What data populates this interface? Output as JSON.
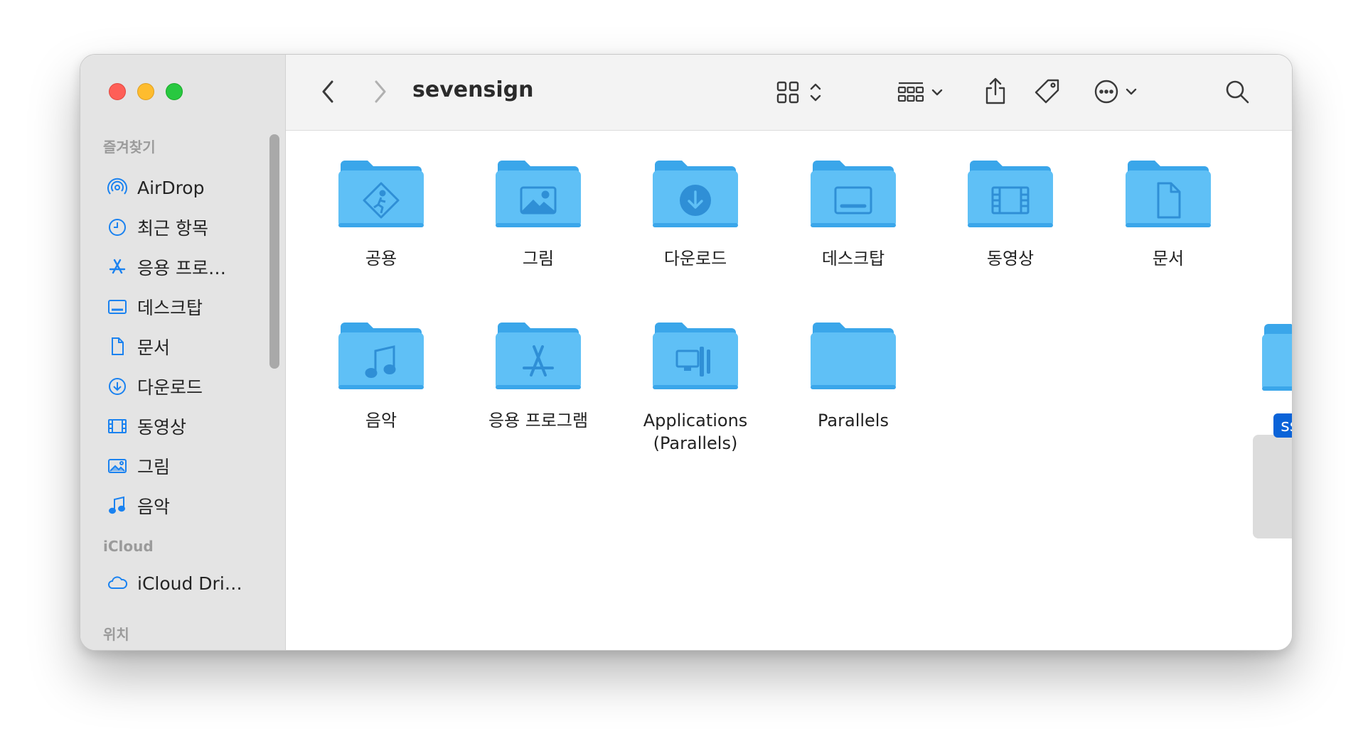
{
  "window": {
    "title": "sevensign"
  },
  "sidebar": {
    "favorites_label": "즐겨찾기",
    "favorites": [
      {
        "label": "AirDrop",
        "icon": "airdrop-icon"
      },
      {
        "label": "최근 항목",
        "icon": "clock-icon"
      },
      {
        "label": "응용 프로…",
        "icon": "apps-icon"
      },
      {
        "label": "데스크탑",
        "icon": "desktop-icon"
      },
      {
        "label": "문서",
        "icon": "document-icon"
      },
      {
        "label": "다운로드",
        "icon": "download-icon"
      },
      {
        "label": "동영상",
        "icon": "film-icon"
      },
      {
        "label": "그림",
        "icon": "photo-icon"
      },
      {
        "label": "음악",
        "icon": "music-icon"
      }
    ],
    "icloud_label": "iCloud",
    "icloud": [
      {
        "label": "iCloud Dri…",
        "icon": "cloud-icon"
      }
    ],
    "locations_label": "위치"
  },
  "files": [
    {
      "label": "공용",
      "icon": "public-folder-icon"
    },
    {
      "label": "그림",
      "icon": "pictures-folder-icon"
    },
    {
      "label": "다운로드",
      "icon": "downloads-folder-icon"
    },
    {
      "label": "데스크탑",
      "icon": "desktop-folder-icon"
    },
    {
      "label": "동영상",
      "icon": "movies-folder-icon"
    },
    {
      "label": "문서",
      "icon": "documents-folder-icon"
    },
    {
      "label": "음악",
      "icon": "music-folder-icon"
    },
    {
      "label": "응용 프로그램",
      "icon": "applications-folder-icon"
    },
    {
      "label": "Applications\n(Parallels)",
      "icon": "parallels-apps-folder-icon"
    },
    {
      "label": "Parallels",
      "icon": "folder-icon"
    },
    {
      "label": "ssdos",
      "icon": "folder-icon",
      "selected": true
    }
  ],
  "colors": {
    "folder": "#5fc0f6",
    "folder_tab": "#3aa6ea",
    "selection": "#0a63d8",
    "sidebar_icon": "#1a82f0"
  }
}
